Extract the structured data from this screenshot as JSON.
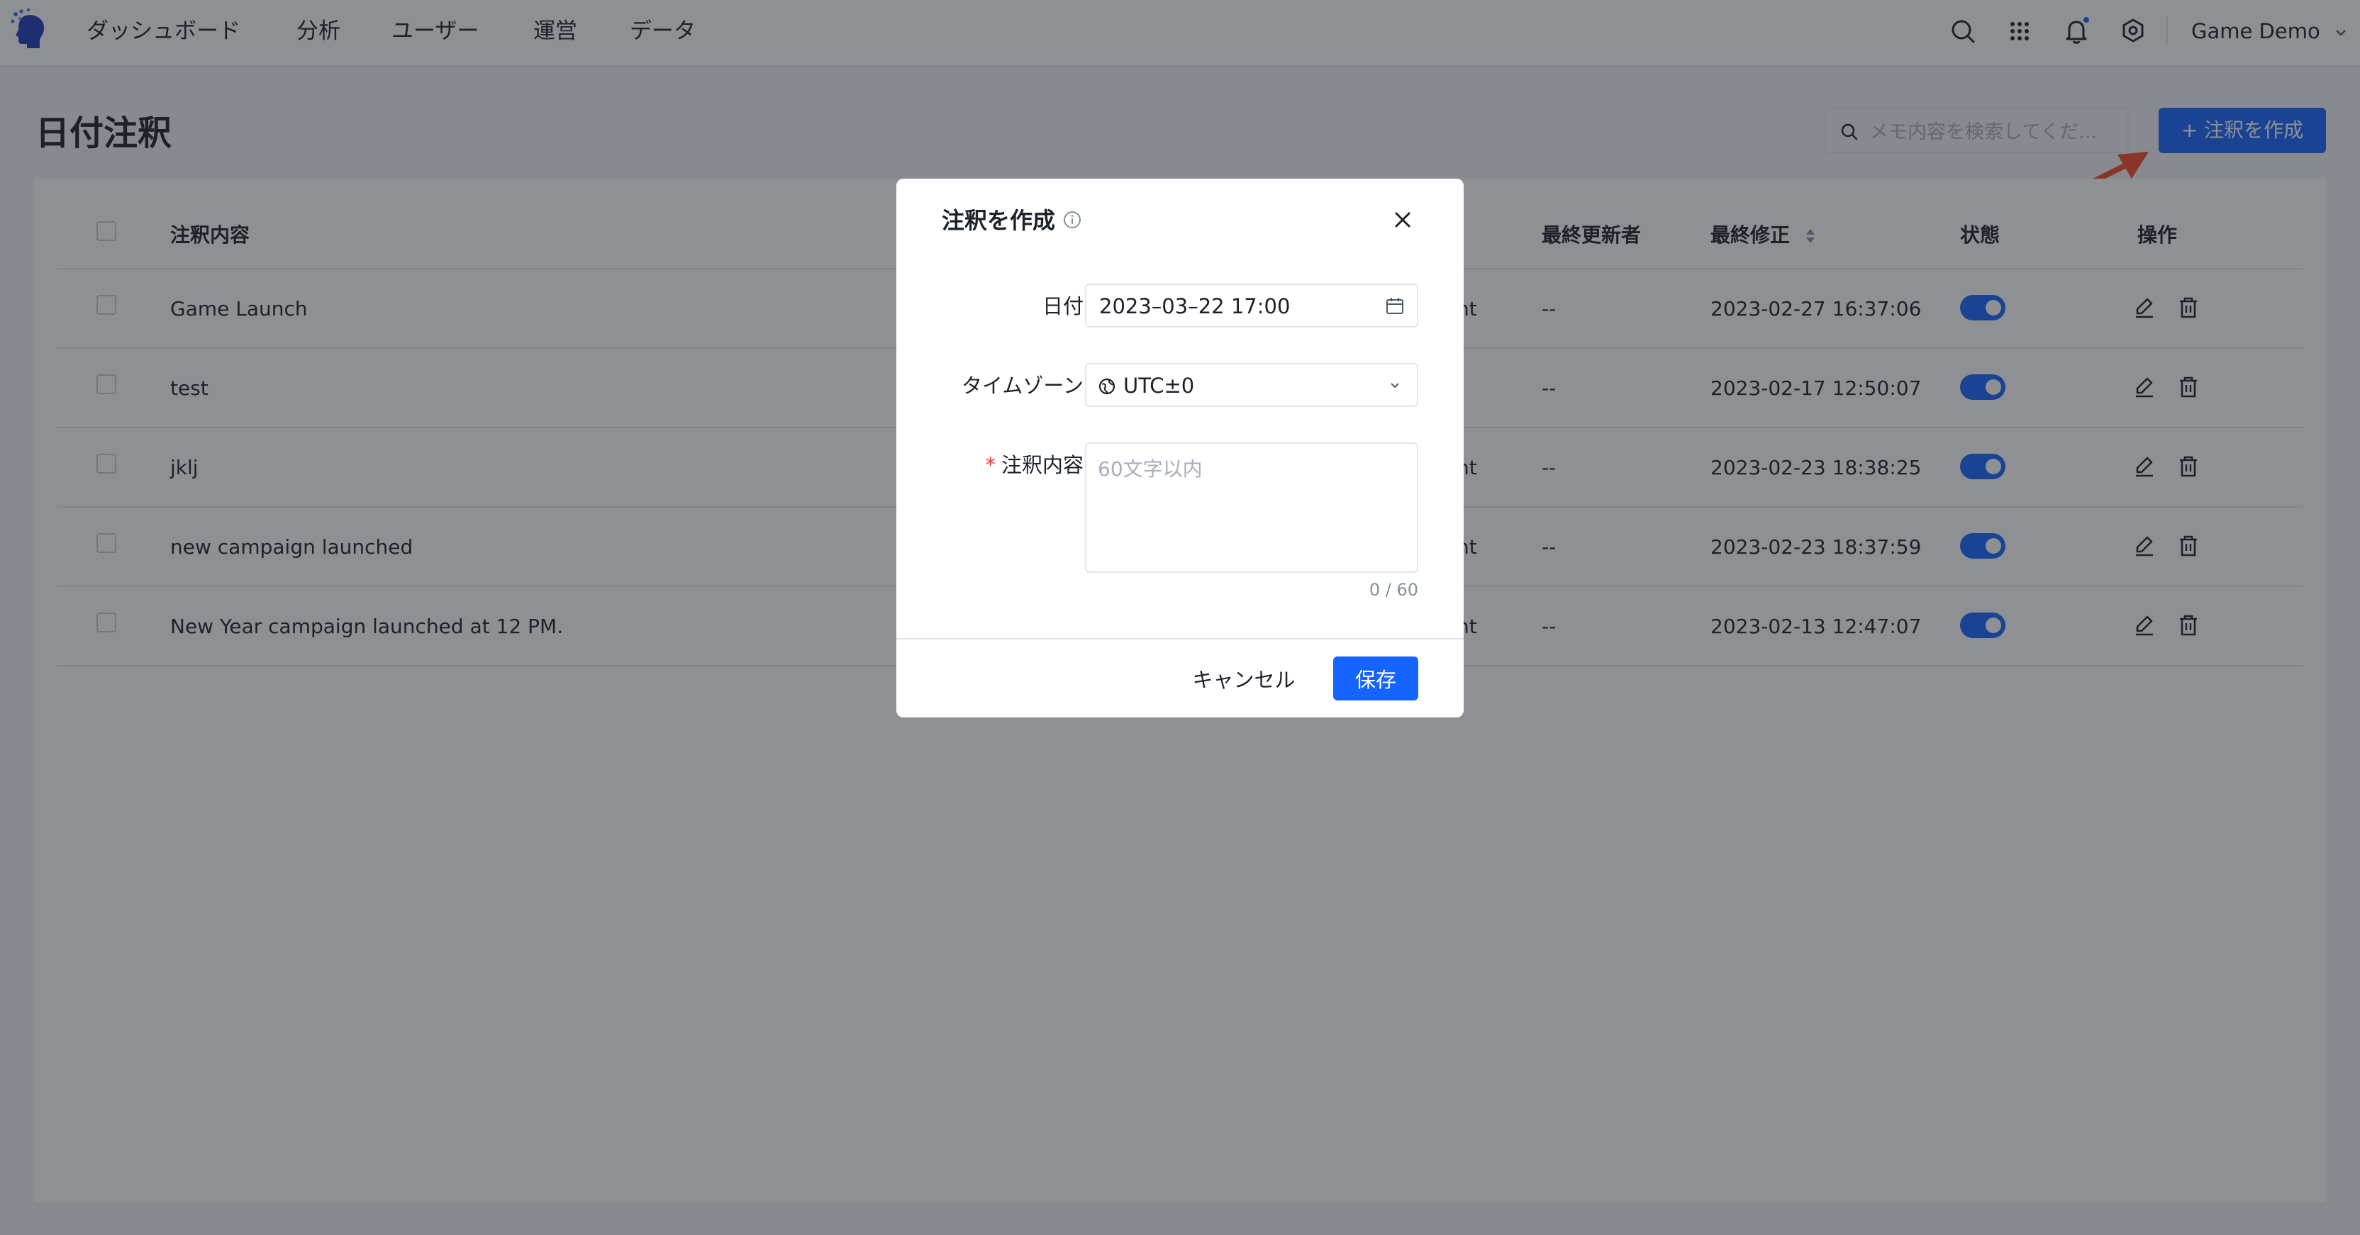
{
  "nav": {
    "items": [
      "ダッシュボード",
      "分析",
      "ユーザー",
      "運営",
      "データ"
    ],
    "user": "Game Demo",
    "icons": [
      "search-icon",
      "apps-grid-icon",
      "bell-icon",
      "settings-icon"
    ]
  },
  "page": {
    "title": "日付注釈",
    "search_placeholder": "メモ内容を検索してくだ...",
    "create_button": "+ 注釈を作成"
  },
  "table": {
    "columns": {
      "content": "注釈内容",
      "updated_by": "最終更新者",
      "modified": "最終修正",
      "status": "状態",
      "actions": "操作"
    },
    "rows": [
      {
        "content": "Game Launch",
        "partial": "nt",
        "updated_by": "--",
        "modified": "2023-02-27 16:37:06",
        "enabled": true
      },
      {
        "content": "test",
        "partial": "",
        "updated_by": "--",
        "modified": "2023-02-17 12:50:07",
        "enabled": true
      },
      {
        "content": "jklj",
        "partial": "nt",
        "updated_by": "--",
        "modified": "2023-02-23 18:38:25",
        "enabled": true
      },
      {
        "content": "new campaign launched",
        "partial": "nt",
        "updated_by": "--",
        "modified": "2023-02-23 18:37:59",
        "enabled": true
      },
      {
        "content": "New Year campaign launched at 12 PM.",
        "partial": "nt",
        "updated_by": "--",
        "modified": "2023-02-13 12:47:07",
        "enabled": true
      }
    ]
  },
  "modal": {
    "title": "注釈を作成",
    "date_label": "日付",
    "date_value": "2023–03–22 17:00",
    "timezone_label": "タイムゾーン",
    "timezone_value": "UTC±0",
    "content_label": "注釈内容",
    "content_placeholder": "60文字以内",
    "counter": "0 / 60",
    "cancel": "キャンセル",
    "save": "保存"
  },
  "colors": {
    "primary": "#1664ff",
    "required": "#f53f3f",
    "annotation_arrow": "#f2492a"
  }
}
